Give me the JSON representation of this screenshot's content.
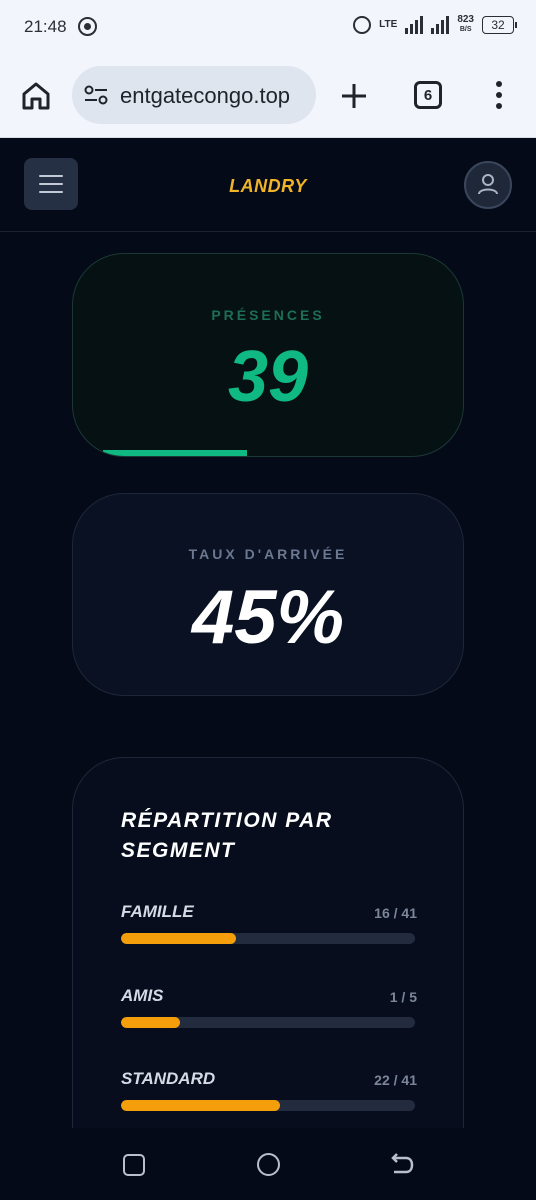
{
  "status_bar": {
    "time": "21:48",
    "network": "LTE",
    "speed_value": "823",
    "speed_unit": "B/S",
    "battery": "32",
    "icons": [
      "whatsapp-icon",
      "alarm-icon",
      "signal-icon",
      "battery-icon"
    ]
  },
  "browser": {
    "url_text": "entgatecongo.top",
    "tab_count": "6",
    "icons": [
      "home-icon",
      "site-settings-icon",
      "new-tab-icon",
      "tabs-icon",
      "menu-icon"
    ]
  },
  "header": {
    "brand": "LANDRY",
    "icons": [
      "hamburger-menu-icon",
      "user-icon"
    ]
  },
  "stats": {
    "presences": {
      "label": "PRÉSENCES",
      "value": "39",
      "progress": 0.45
    },
    "taux": {
      "label": "TAUX D'ARRIVÉE",
      "value": "45%"
    }
  },
  "segments": {
    "title": "RÉPARTITION PAR SEGMENT",
    "items": [
      {
        "name": "FAMILLE",
        "count": "16 / 41",
        "fraction": 0.39
      },
      {
        "name": "AMIS",
        "count": "1 / 5",
        "fraction": 0.2
      },
      {
        "name": "STANDARD",
        "count": "22 / 41",
        "fraction": 0.54
      }
    ]
  },
  "colors": {
    "accent_brand": "#f0b429",
    "success": "#10b981",
    "segment_fill": "#f59e0b",
    "background": "#050a18"
  }
}
